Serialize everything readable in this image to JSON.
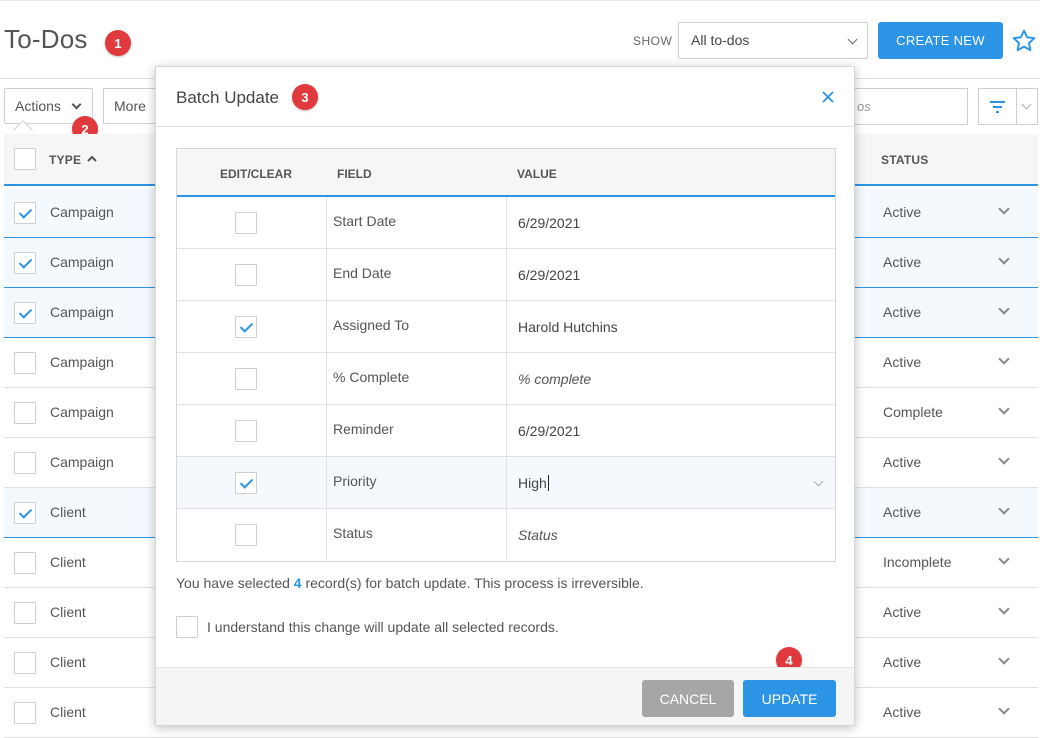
{
  "header": {
    "title": "To-Dos",
    "show_label": "SHOW",
    "show_value": "All to-dos",
    "create_label": "CREATE NEW",
    "badge": "1"
  },
  "toolbar": {
    "actions_label": "Actions",
    "more_label": "More",
    "search_placeholder": "os",
    "badge": "2"
  },
  "table": {
    "columns": {
      "type": "TYPE",
      "status": "STATUS"
    },
    "rows": [
      {
        "type": "Campaign",
        "status": "Active",
        "checked": true
      },
      {
        "type": "Campaign",
        "status": "Active",
        "checked": true
      },
      {
        "type": "Campaign",
        "status": "Active",
        "checked": true
      },
      {
        "type": "Campaign",
        "status": "Active",
        "checked": false
      },
      {
        "type": "Campaign",
        "status": "Complete",
        "checked": false
      },
      {
        "type": "Campaign",
        "status": "Active",
        "checked": false
      },
      {
        "type": "Client",
        "status": "Active",
        "checked": true
      },
      {
        "type": "Client",
        "status": "Incomplete",
        "checked": false
      },
      {
        "type": "Client",
        "status": "Active",
        "checked": false
      },
      {
        "type": "Client",
        "status": "Active",
        "checked": false
      },
      {
        "type": "Client",
        "status": "Active",
        "checked": false
      }
    ]
  },
  "modal": {
    "title": "Batch Update",
    "badge_title": "3",
    "columns": {
      "edit_clear": "EDIT/CLEAR",
      "field": "FIELD",
      "value": "VALUE"
    },
    "fields": [
      {
        "field": "Start Date",
        "value": "6/29/2021",
        "checked": false,
        "placeholder": false
      },
      {
        "field": "End Date",
        "value": "6/29/2021",
        "checked": false,
        "placeholder": false
      },
      {
        "field": "Assigned To",
        "value": "Harold Hutchins",
        "checked": true,
        "placeholder": false
      },
      {
        "field": "% Complete",
        "value": "% complete",
        "checked": false,
        "placeholder": true
      },
      {
        "field": "Reminder",
        "value": "6/29/2021",
        "checked": false,
        "placeholder": false
      },
      {
        "field": "Priority",
        "value": "High",
        "checked": true,
        "placeholder": false
      },
      {
        "field": "Status",
        "value": "Status",
        "checked": false,
        "placeholder": true
      }
    ],
    "notice_prefix": "You have selected ",
    "notice_count": "4",
    "notice_suffix": " record(s) for batch update. This process is irreversible.",
    "acknowledge_label": "I understand this change will update all selected records.",
    "cancel_label": "CANCEL",
    "update_label": "UPDATE",
    "badge_update": "4"
  },
  "colors": {
    "accent": "#2b94e5",
    "badge": "#e0393e"
  }
}
